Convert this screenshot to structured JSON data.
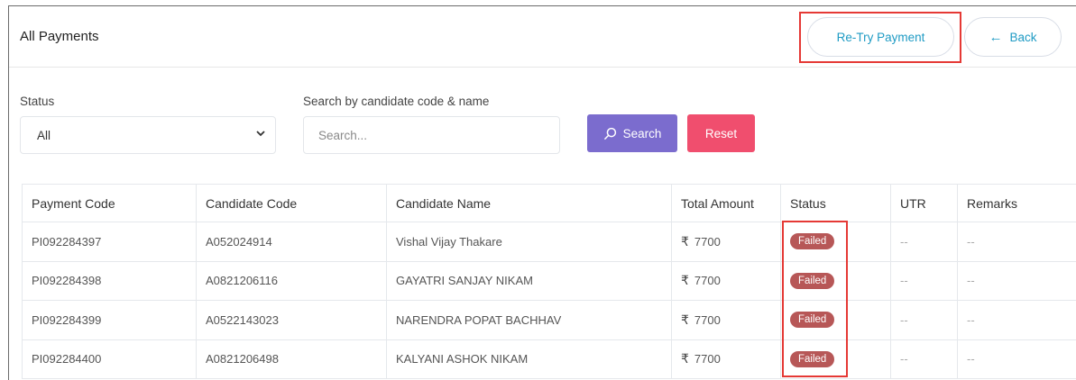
{
  "page": {
    "title": "All Payments"
  },
  "header": {
    "retry_label": "Re-Try Payment",
    "back_label": "Back"
  },
  "filters": {
    "status_label": "Status",
    "status_selected": "All",
    "search_label": "Search by candidate code & name",
    "search_placeholder": "Search...",
    "search_button": "Search",
    "reset_button": "Reset"
  },
  "table": {
    "columns": [
      "Payment Code",
      "Candidate Code",
      "Candidate Name",
      "Total Amount",
      "Status",
      "UTR",
      "Remarks"
    ],
    "rows": [
      {
        "payment_code": "PI092284397",
        "candidate_code": "A052024914",
        "candidate_name": "Vishal Vijay Thakare",
        "currency": "₹",
        "amount": "7700",
        "status": "Failed",
        "utr": "--",
        "remarks": "--"
      },
      {
        "payment_code": "PI092284398",
        "candidate_code": "A0821206116",
        "candidate_name": "GAYATRI SANJAY NIKAM",
        "currency": "₹",
        "amount": "7700",
        "status": "Failed",
        "utr": "--",
        "remarks": "--"
      },
      {
        "payment_code": "PI092284399",
        "candidate_code": "A0522143023",
        "candidate_name": "NARENDRA POPAT BACHHAV",
        "currency": "₹",
        "amount": "7700",
        "status": "Failed",
        "utr": "--",
        "remarks": "--"
      },
      {
        "payment_code": "PI092284400",
        "candidate_code": "A0821206498",
        "candidate_name": "KALYANI ASHOK NIKAM",
        "currency": "₹",
        "amount": "7700",
        "status": "Failed",
        "utr": "--",
        "remarks": "--"
      }
    ]
  },
  "icons": {
    "back": "arrow-left-icon",
    "search": "search-icon",
    "dropdown": "chevron-down-icon"
  },
  "colors": {
    "accent": "#1f9bc4",
    "search_button": "#7b6cce",
    "reset_button": "#f04e6e",
    "failed_badge": "#b75757",
    "highlight": "#e53935"
  }
}
